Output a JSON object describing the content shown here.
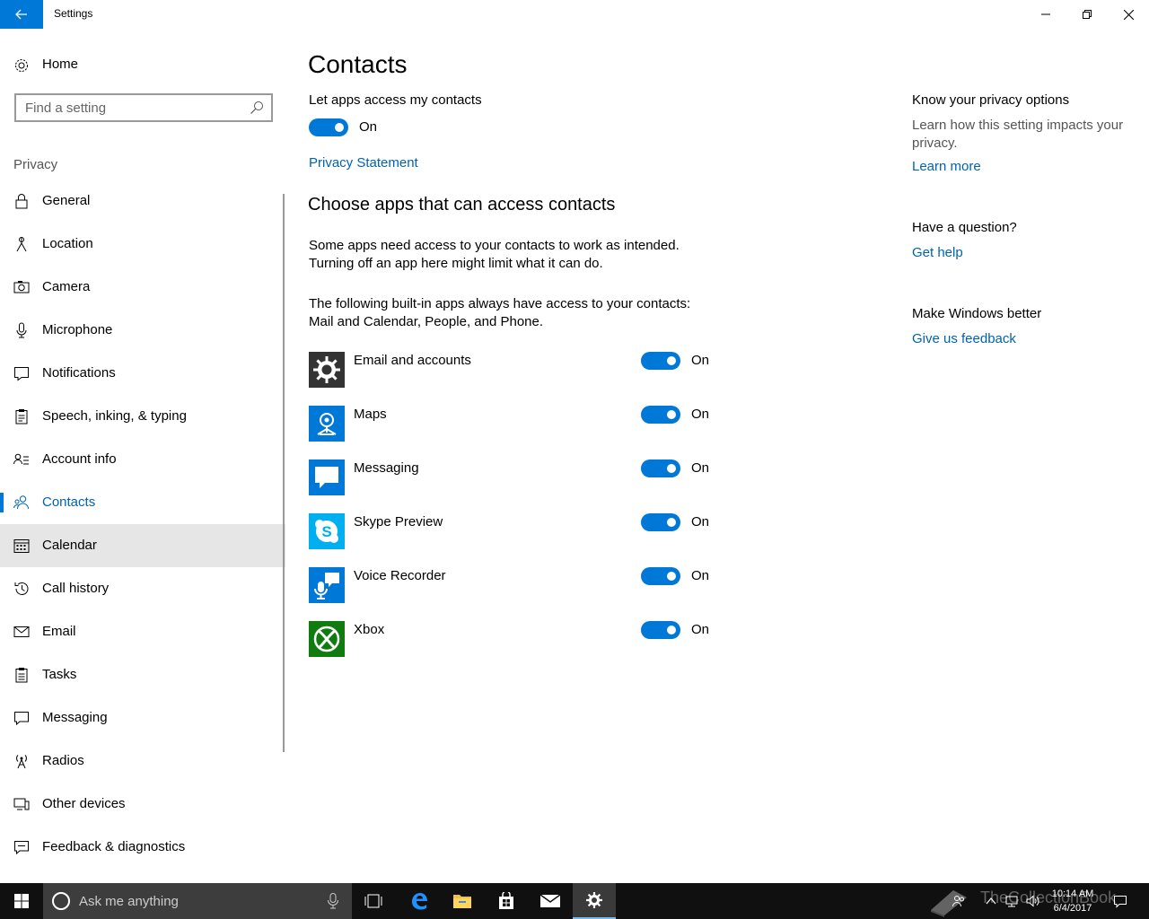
{
  "window": {
    "title": "Settings"
  },
  "sidebar": {
    "home_label": "Home",
    "search_placeholder": "Find a setting",
    "section_label": "Privacy",
    "items": [
      {
        "label": "General",
        "icon": "lock-icon"
      },
      {
        "label": "Location",
        "icon": "location-icon"
      },
      {
        "label": "Camera",
        "icon": "camera-icon"
      },
      {
        "label": "Microphone",
        "icon": "microphone-icon"
      },
      {
        "label": "Notifications",
        "icon": "notifications-icon"
      },
      {
        "label": "Speech, inking, & typing",
        "icon": "clipboard-icon"
      },
      {
        "label": "Account info",
        "icon": "account-info-icon"
      },
      {
        "label": "Contacts",
        "icon": "contacts-icon",
        "active": true
      },
      {
        "label": "Calendar",
        "icon": "calendar-icon",
        "hover": true
      },
      {
        "label": "Call history",
        "icon": "history-icon"
      },
      {
        "label": "Email",
        "icon": "mail-icon"
      },
      {
        "label": "Tasks",
        "icon": "tasks-icon"
      },
      {
        "label": "Messaging",
        "icon": "message-icon"
      },
      {
        "label": "Radios",
        "icon": "radio-tower-icon"
      },
      {
        "label": "Other devices",
        "icon": "devices-icon"
      },
      {
        "label": "Feedback & diagnostics",
        "icon": "feedback-icon"
      }
    ]
  },
  "main": {
    "title": "Contacts",
    "master_label": "Let apps access my contacts",
    "master_state": "On",
    "privacy_link": "Privacy Statement",
    "subtitle": "Choose apps that can access contacts",
    "para1_line1": "Some apps need access to your contacts to work as intended.",
    "para1_line2": "Turning off an app here might limit what it can do.",
    "para2_line1": "The following built-in apps always have access to your contacts:",
    "para2_line2": "Mail and Calendar, People, and Phone.",
    "apps": [
      {
        "name": "Email and accounts",
        "state": "On",
        "icon": "gear-app-icon",
        "color": "#333333"
      },
      {
        "name": "Maps",
        "state": "On",
        "icon": "maps-app-icon",
        "color": "#0078d7"
      },
      {
        "name": "Messaging",
        "state": "On",
        "icon": "messaging-app-icon",
        "color": "#0078d7"
      },
      {
        "name": "Skype Preview",
        "state": "On",
        "icon": "skype-app-icon",
        "color": "#00aff0"
      },
      {
        "name": "Voice Recorder",
        "state": "On",
        "icon": "voice-recorder-app-icon",
        "color": "#0078d7"
      },
      {
        "name": "Xbox",
        "state": "On",
        "icon": "xbox-app-icon",
        "color": "#107c10"
      }
    ]
  },
  "rightpane": {
    "privacy_head": "Know your privacy options",
    "privacy_text": "Learn how this setting impacts your privacy.",
    "learn_more": "Learn more",
    "question_head": "Have a question?",
    "get_help": "Get help",
    "better_head": "Make Windows better",
    "feedback_link": "Give us feedback"
  },
  "taskbar": {
    "search_placeholder": "Ask me anything",
    "time": "10:14 AM",
    "date": "6/4/2017",
    "watermark": "TheCollectionBook"
  },
  "colors": {
    "accent": "#0078d7",
    "link": "#0063b1",
    "taskbar": "#101010"
  }
}
